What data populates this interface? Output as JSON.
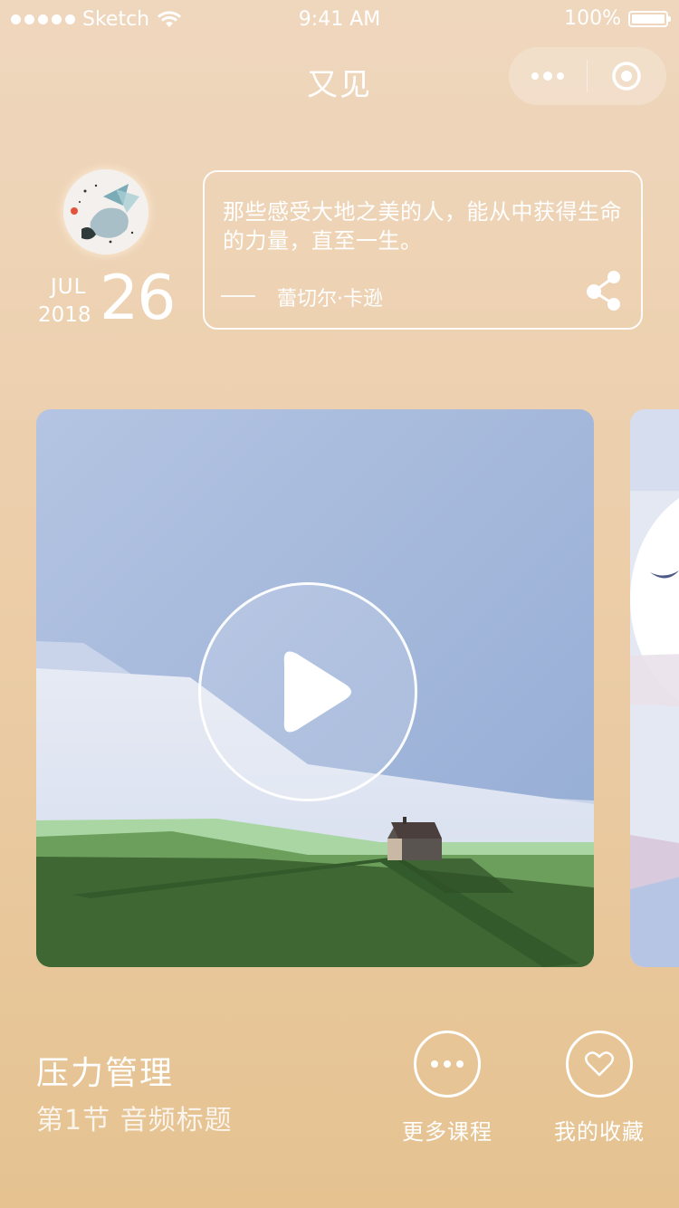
{
  "status_bar": {
    "carrier": "Sketch",
    "time": "9:41 AM",
    "battery": "100%"
  },
  "nav": {
    "title": "又见"
  },
  "date": {
    "month": "JUL",
    "year": "2018",
    "day": "26"
  },
  "quote": {
    "text": "那些感受大地之美的人，能从中获得生命的力量，直至一生。",
    "author": "蕾切尔·卡逊"
  },
  "course": {
    "title": "压力管理",
    "subtitle": "第1节  音频标题"
  },
  "actions": {
    "more_courses": "更多课程",
    "my_favorites": "我的收藏"
  },
  "icons": [
    "wifi-icon",
    "battery-icon",
    "more-icon",
    "target-icon",
    "share-icon",
    "play-icon",
    "heart-icon"
  ],
  "colors": {
    "background_top": "#efd7be",
    "background_bottom": "#e5c290",
    "sky": "#9fb4dc",
    "grass": "#3f6734"
  }
}
